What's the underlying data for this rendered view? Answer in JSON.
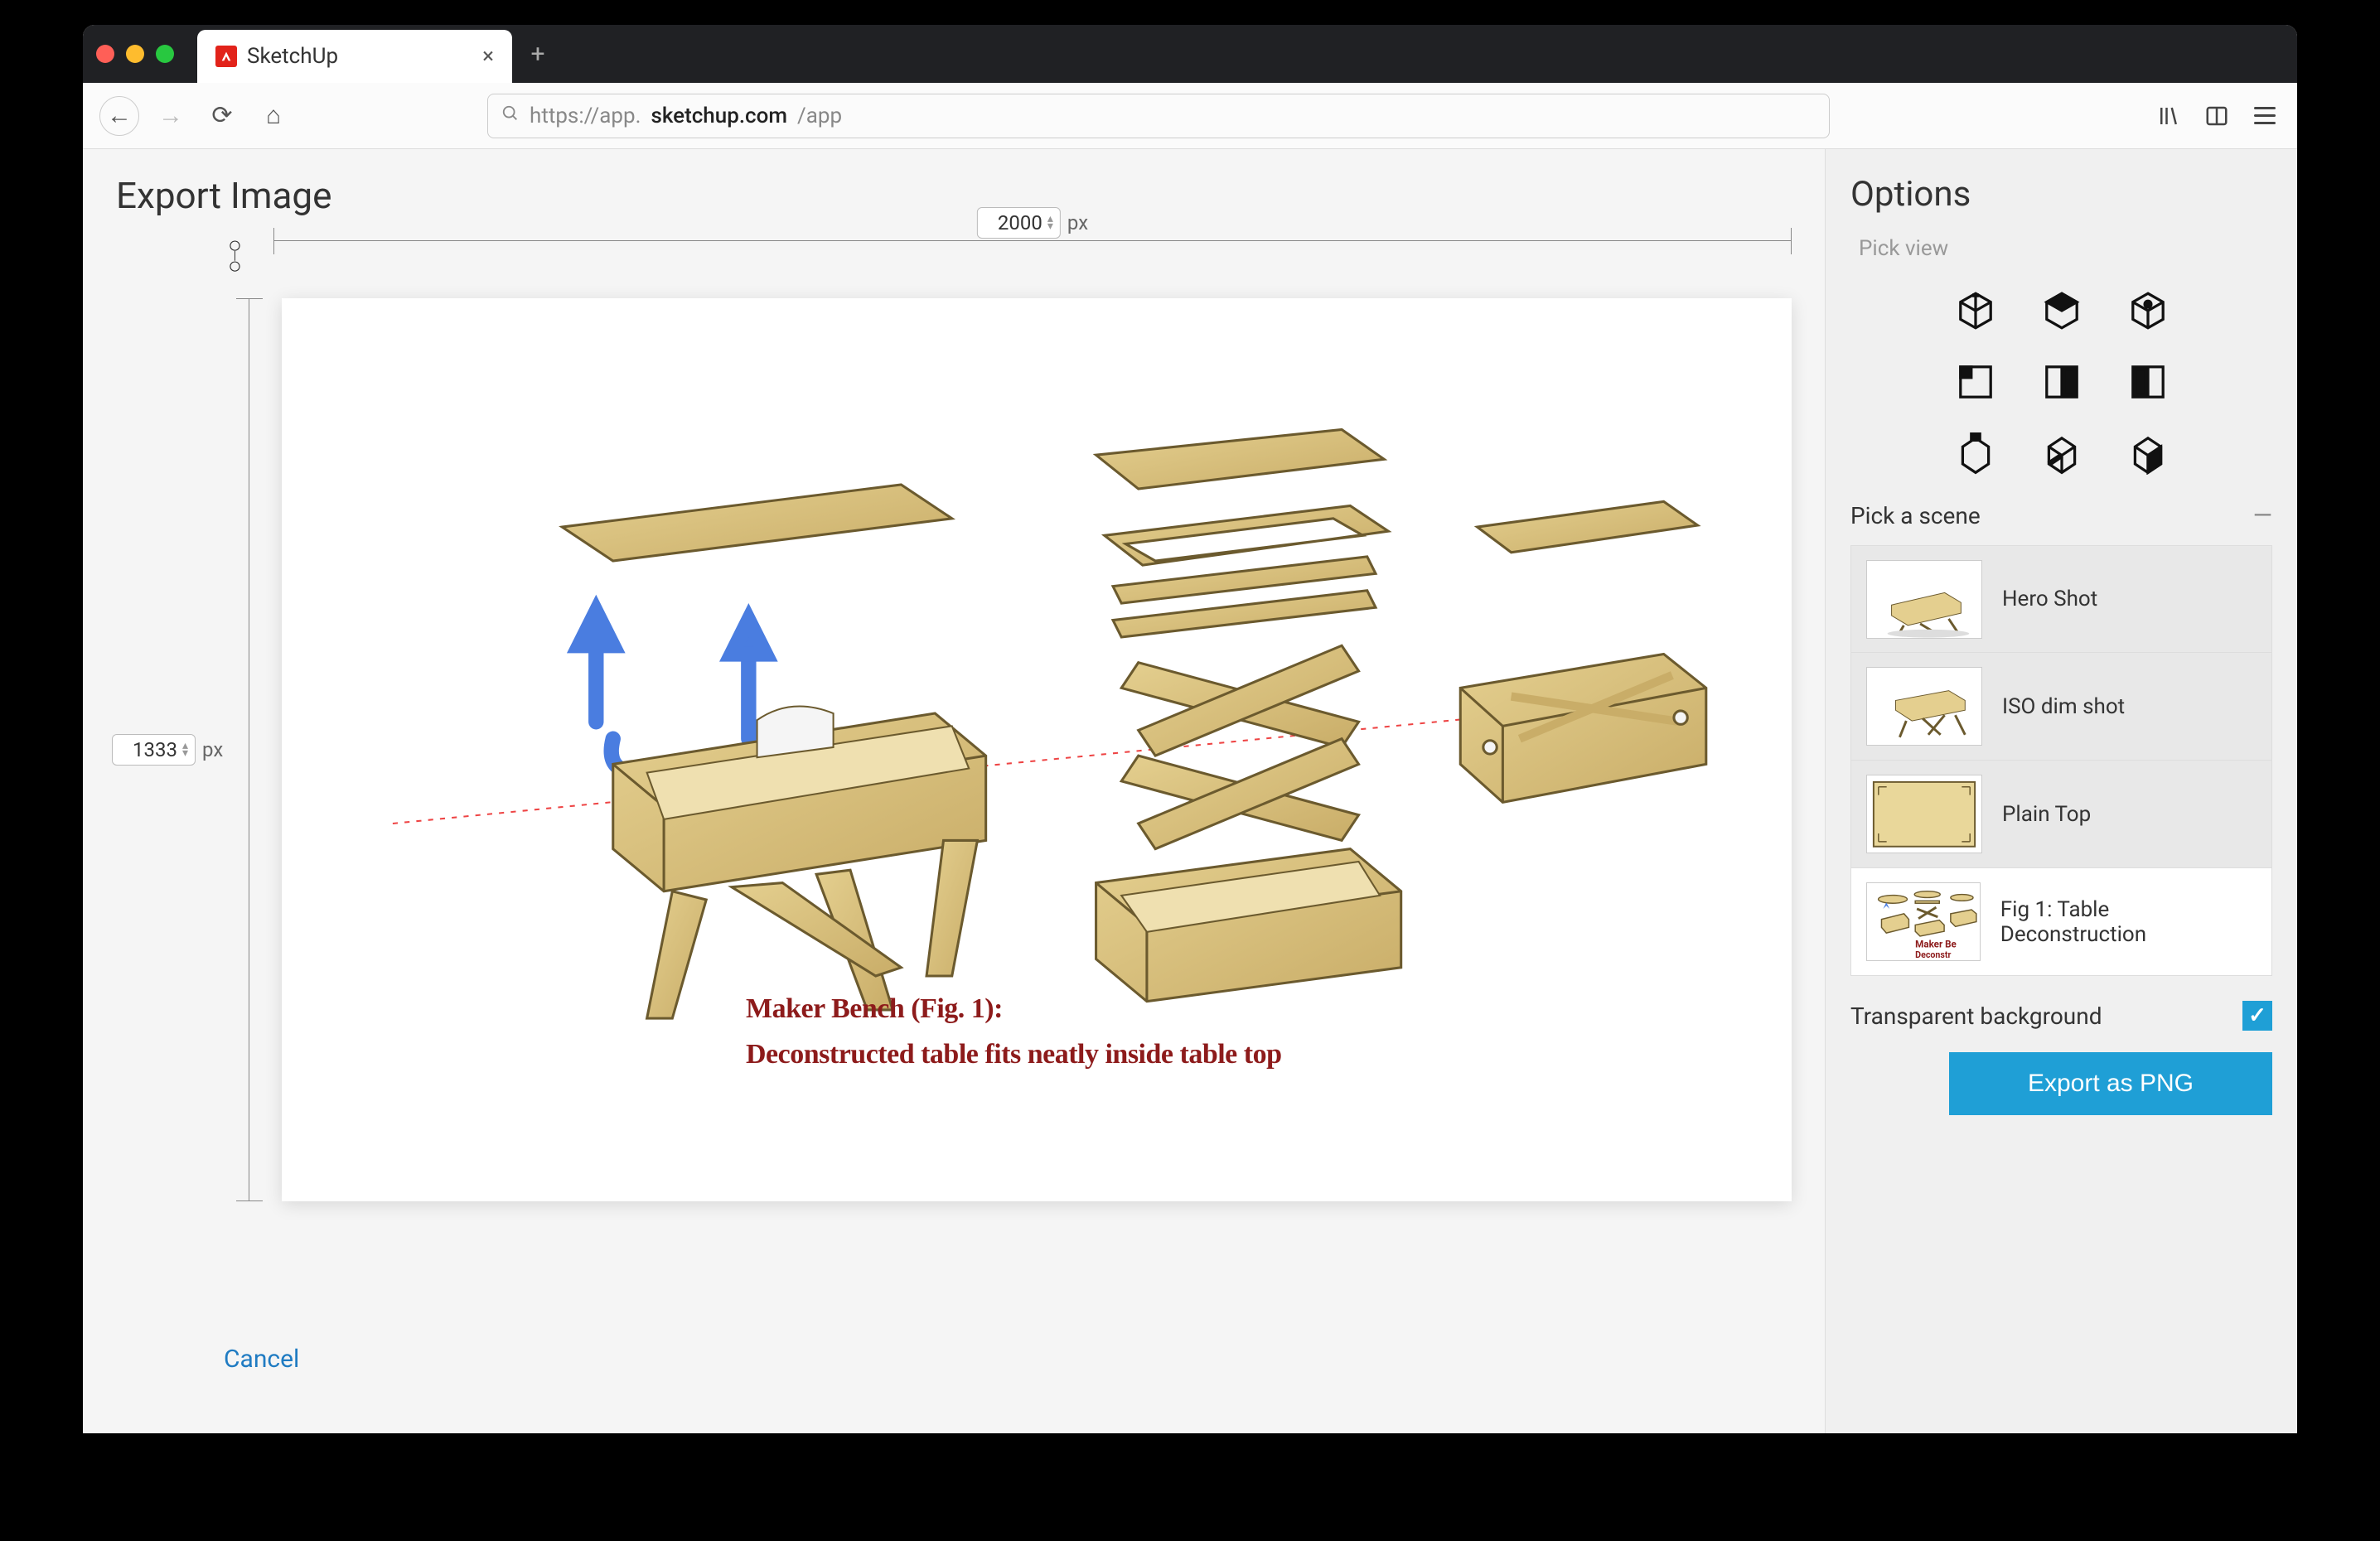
{
  "browser": {
    "tab_title": "SketchUp",
    "url_prefix": "https://app.",
    "url_host": "sketchup.com",
    "url_path": "/app"
  },
  "page": {
    "title": "Export Image",
    "width_value": "2000",
    "height_value": "1333",
    "px_label_w": "px",
    "px_label_h": "px",
    "cancel": "Cancel"
  },
  "caption": {
    "line1": "Maker Bench (Fig. 1):",
    "line2": "Deconstructed table fits neatly inside table top"
  },
  "options": {
    "title": "Options",
    "pick_view": "Pick view",
    "pick_scene": "Pick a scene",
    "scenes": [
      {
        "label": "Hero Shot"
      },
      {
        "label": "ISO dim shot"
      },
      {
        "label": "Plain Top"
      },
      {
        "label": "Fig 1: Table Deconstruction"
      }
    ],
    "selected_scene_index": 3,
    "transparent_bg": "Transparent background",
    "transparent_checked": true,
    "export_label": "Export as PNG",
    "thumb4_line1": "Maker Be",
    "thumb4_line2": "Deconstr"
  }
}
